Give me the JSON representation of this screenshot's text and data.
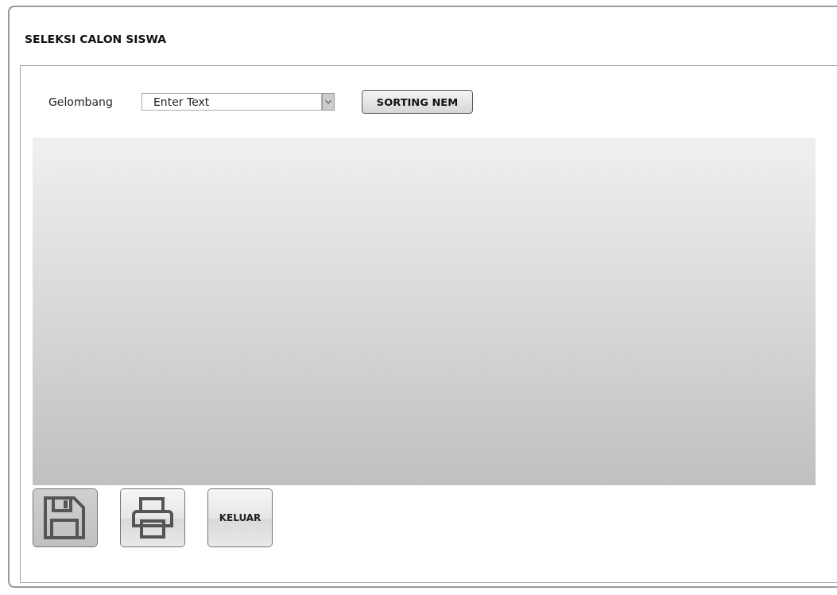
{
  "window": {
    "title": "SELEKSI CALON SISWA"
  },
  "filter": {
    "label": "Gelombang",
    "placeholder": "Enter Text"
  },
  "sort_button": {
    "label": "SORTING NEM"
  },
  "actions": [
    {
      "kind": "save"
    },
    {
      "kind": "print"
    },
    {
      "kind": "text",
      "label": "KELUAR"
    }
  ]
}
